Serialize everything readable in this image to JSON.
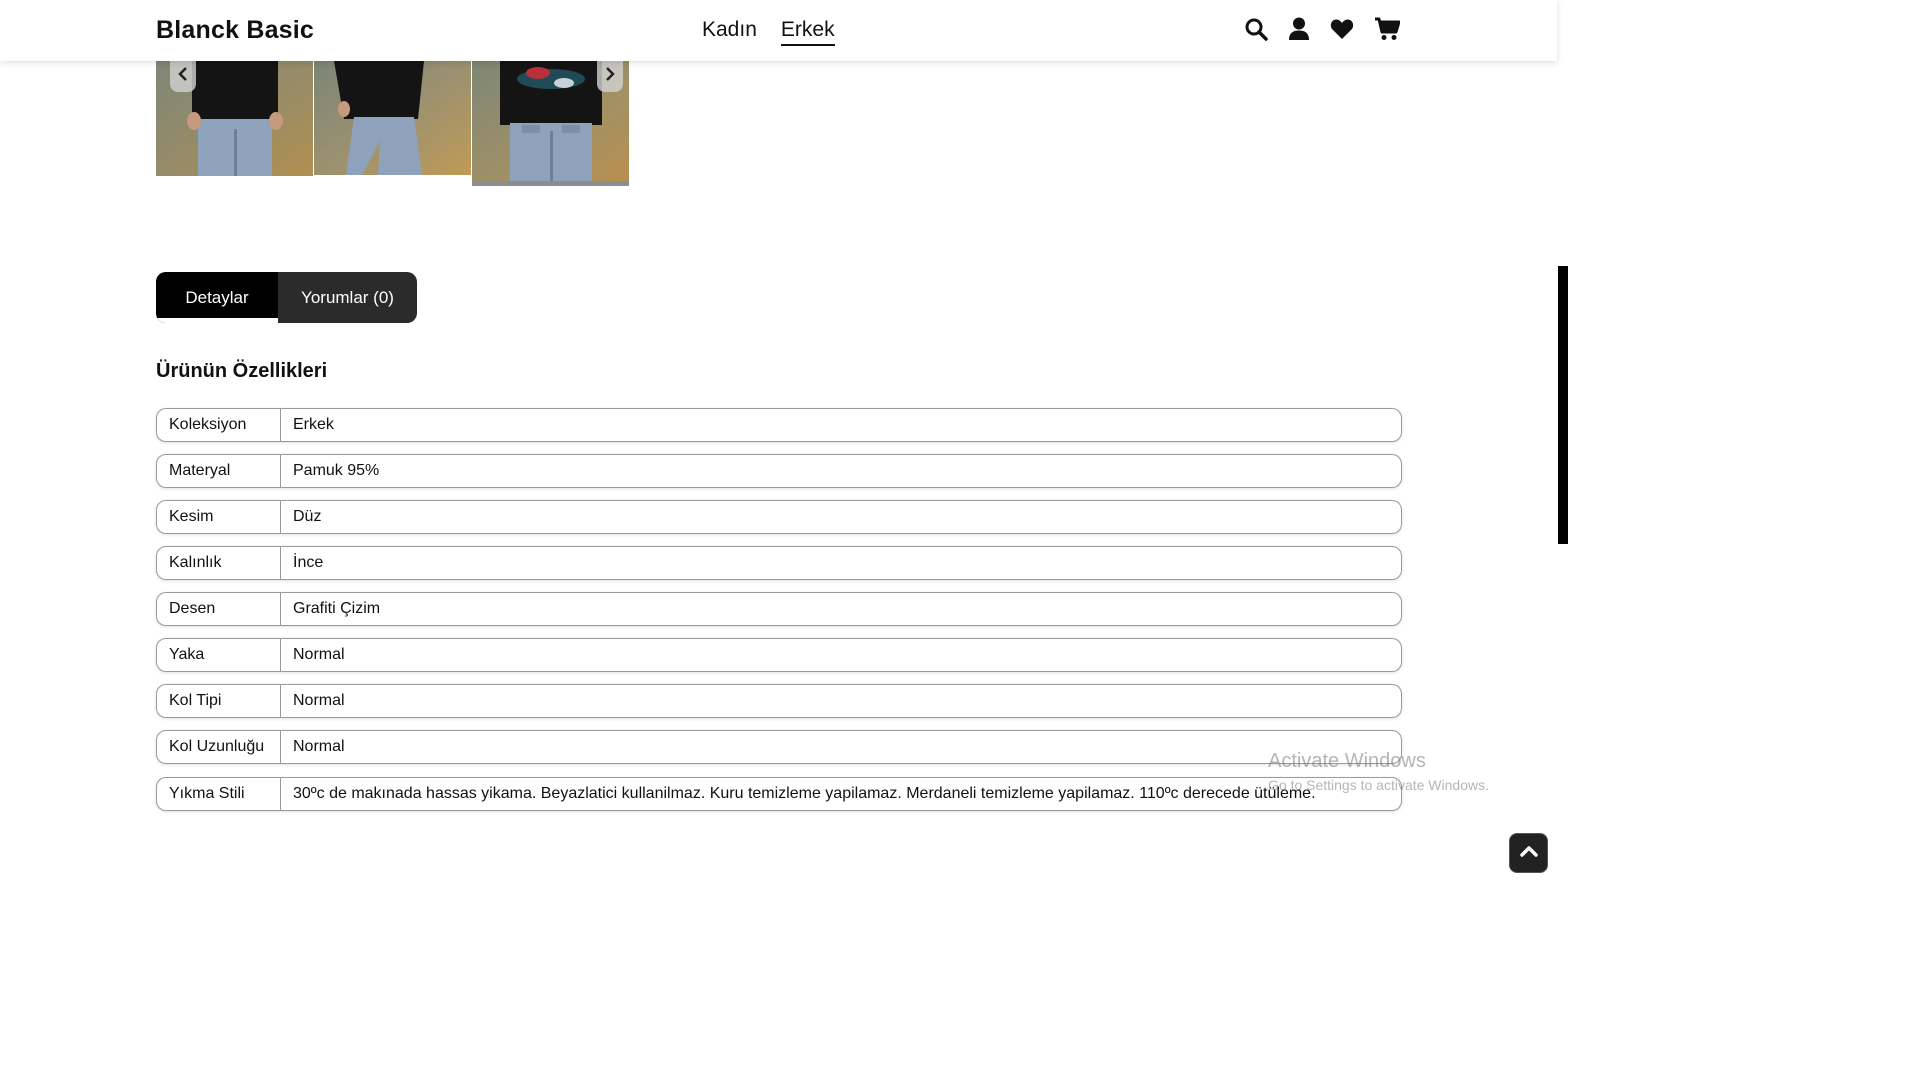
{
  "header": {
    "brand": "Blanck Basic",
    "nav": [
      {
        "label": "Kadın",
        "active": false
      },
      {
        "label": "Erkek",
        "active": true
      }
    ],
    "icons": [
      "search-icon",
      "user-icon",
      "heart-icon",
      "cart-icon"
    ]
  },
  "gallery": {
    "thumbnail_count": 3,
    "selected_index": 2
  },
  "tabs": [
    {
      "label": "Detaylar",
      "active": true
    },
    {
      "label": "Yorumlar (0)",
      "active": false
    }
  ],
  "section_title": "Ürünün Özellikleri",
  "specs": [
    {
      "key": "Koleksiyon",
      "value": "Erkek"
    },
    {
      "key": "Materyal",
      "value": "Pamuk 95%"
    },
    {
      "key": "Kesim",
      "value": "Düz"
    },
    {
      "key": "Kalınlık",
      "value": "İnce"
    },
    {
      "key": "Desen",
      "value": "Grafiti Çizim"
    },
    {
      "key": "Yaka",
      "value": "Normal"
    },
    {
      "key": "Kol Tipi",
      "value": "Normal"
    },
    {
      "key": "Kol Uzunluğu",
      "value": "Normal"
    },
    {
      "key": "Yıkma Stili",
      "value": "30ºc de makınada hassas yikama. Beyazlatici kullanilmaz. Kuru temizleme yapilamaz. Merdaneli temizleme yapilamaz. 110ºc derecede ütüleme."
    }
  ],
  "watermark": {
    "line1": "Activate Windows",
    "line2": "Go to Settings to activate Windows."
  }
}
